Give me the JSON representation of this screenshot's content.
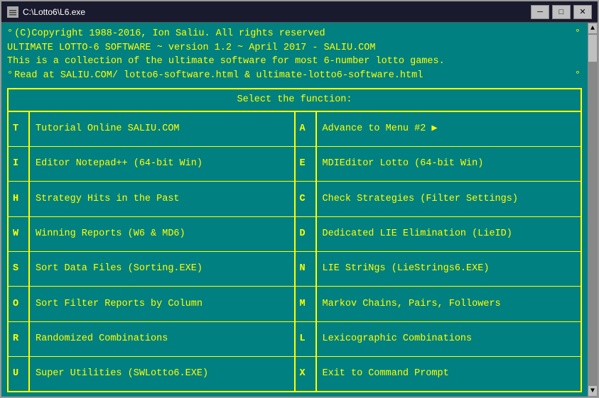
{
  "titlebar": {
    "title": "C:\\Lotto6\\L6.exe",
    "minimize": "─",
    "maximize": "□",
    "close": "✕",
    "icon_label": "terminal-icon"
  },
  "header": {
    "line1": "(C)Copyright 1988-2016, Ion Saliu. All rights reserved",
    "line2": "ULTIMATE LOTTO-6 SOFTWARE ~ version 1.2 ~ April 2017 - SALIU.COM",
    "line3": "This is a collection of the ultimate software for most 6-number lotto games.",
    "line4": "Read at SALIU.COM/ lotto6-software.html & ultimate-lotto6-software.html"
  },
  "menu": {
    "title": "Select the function:",
    "rows": [
      {
        "left_key": "T",
        "left_label": "Tutorial Online SALIU.COM",
        "right_key": "A",
        "right_label": "Advance to Menu #2 ▶"
      },
      {
        "left_key": "I",
        "left_label": "Editor Notepad++ (64-bit Win)",
        "right_key": "E",
        "right_label": "MDIEditor Lotto (64-bit Win)"
      },
      {
        "left_key": "H",
        "left_label": "Strategy Hits in the Past",
        "right_key": "C",
        "right_label": "Check Strategies (Filter Settings)"
      },
      {
        "left_key": "W",
        "left_label": "Winning Reports (W6 & MD6)",
        "right_key": "D",
        "right_label": "Dedicated LIE Elimination (LieID)"
      },
      {
        "left_key": "S",
        "left_label": "Sort Data Files (Sorting.EXE)",
        "right_key": "N",
        "right_label": "LIE StriNgs (LieStrings6.EXE)"
      },
      {
        "left_key": "O",
        "left_label": "Sort Filter Reports by Column",
        "right_key": "M",
        "right_label": "Markov Chains, Pairs, Followers"
      },
      {
        "left_key": "R",
        "left_label": "Randomized Combinations",
        "right_key": "L",
        "right_label": "Lexicographic Combinations"
      },
      {
        "left_key": "U",
        "left_label": "Super Utilities (SWLotto6.EXE)",
        "right_key": "X",
        "right_label": "Exit to Command Prompt"
      }
    ]
  }
}
